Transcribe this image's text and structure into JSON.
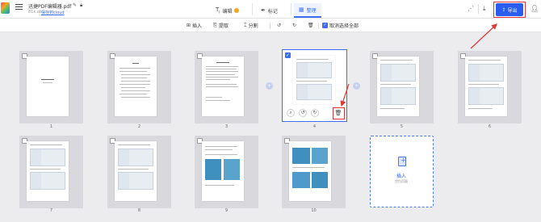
{
  "header": {
    "file_title": "迅捷PDF编辑器.pdf",
    "file_size": "81k.ab",
    "save_link": "保存到cloud",
    "tabs": [
      {
        "label": "编辑",
        "icon": "text-edit-icon"
      },
      {
        "label": "标记",
        "icon": "pen-icon"
      },
      {
        "label": "整理",
        "icon": "grid-organize-icon"
      }
    ],
    "export_label": "导出"
  },
  "toolbar": {
    "insert": "插入",
    "extract": "提取",
    "split": "分割",
    "cancel_select_all": "取消选择全部"
  },
  "pages": [
    "1",
    "2",
    "3",
    "4",
    "5",
    "6",
    "7",
    "8",
    "9",
    "10"
  ],
  "insert_card": {
    "label": "插入",
    "sublabel": "空白页面"
  },
  "colors": {
    "accent": "#2b5cf0",
    "annotation": "#e13737",
    "background": "#ececef"
  }
}
